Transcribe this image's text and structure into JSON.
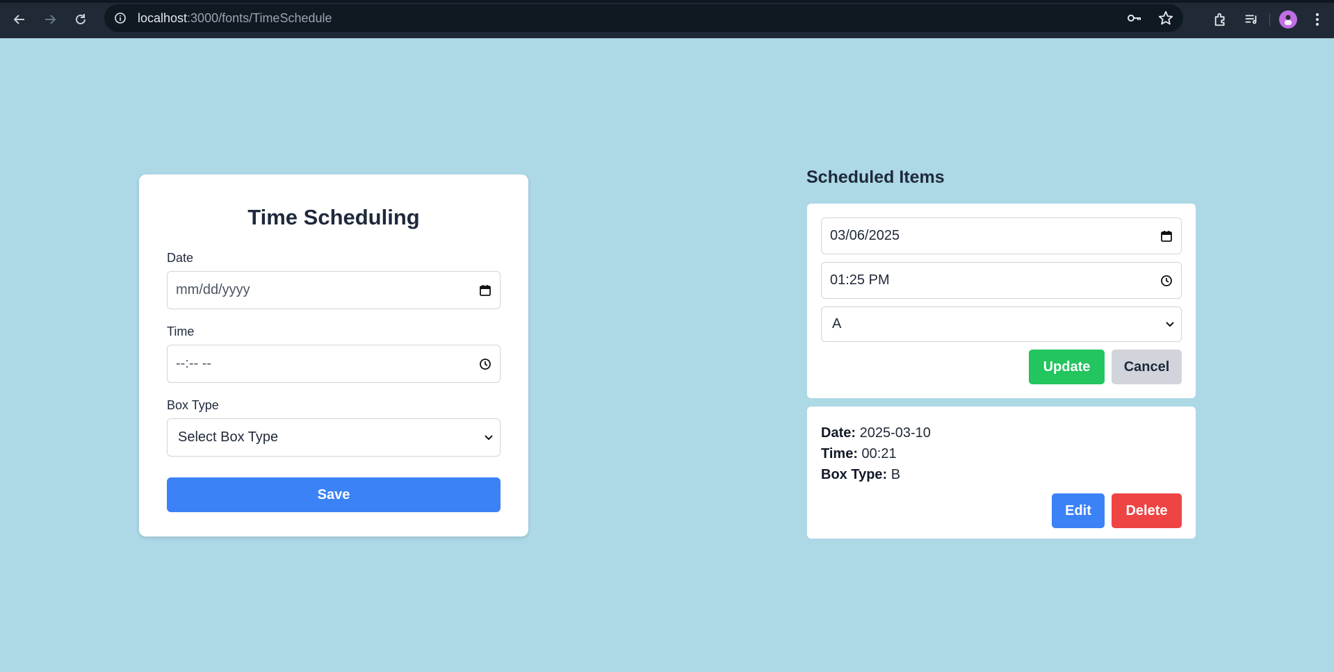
{
  "browser": {
    "url_host": "localhost",
    "url_path": ":3000/fonts/TimeSchedule",
    "icons": [
      "back-icon",
      "forward-icon",
      "reload-icon",
      "info-icon",
      "password-key-icon",
      "bookmark-star-icon",
      "extensions-icon",
      "media-queue-icon",
      "profile-avatar",
      "menu-icon"
    ]
  },
  "form": {
    "title": "Time Scheduling",
    "date_label": "Date",
    "date_value": "mm/dd/yyyy",
    "time_label": "Time",
    "time_value": "--:-- --",
    "box_type_label": "Box Type",
    "box_type_value": "Select Box Type",
    "save_label": "Save"
  },
  "scheduled": {
    "title": "Scheduled Items",
    "editing": {
      "date_value": "03/06/2025",
      "time_value": "01:25 PM",
      "box_type_value": "A",
      "update_label": "Update",
      "cancel_label": "Cancel"
    },
    "items": [
      {
        "date_label": "Date:",
        "date_value": "2025-03-10",
        "time_label": "Time:",
        "time_value": "00:21",
        "box_type_label": "Box Type:",
        "box_type_value": "B",
        "edit_label": "Edit",
        "delete_label": "Delete"
      }
    ]
  },
  "colors": {
    "page_background": "#add8e6",
    "primary": "#3b82f6",
    "success": "#22c55e",
    "danger": "#ef4444",
    "neutral": "#d1d5db"
  }
}
